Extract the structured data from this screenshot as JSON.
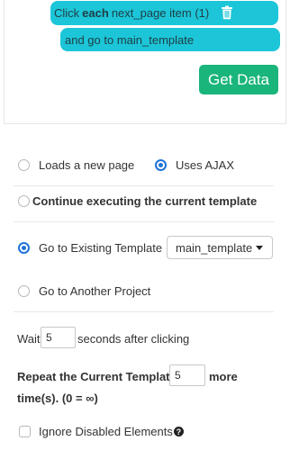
{
  "steps": {
    "click_prefix": "Click",
    "click_keyword": "each",
    "click_target": "next_page item (1)",
    "second_line": "and go to main_template"
  },
  "actions": {
    "get_data_label": "Get Data"
  },
  "load_type": {
    "new_page_label": "Loads a new page",
    "ajax_label": "Uses AJAX",
    "selected": "ajax"
  },
  "continue_label": "Continue executing the current template",
  "goto": {
    "existing_label": "Go to Existing Template",
    "selected_template": "main_template",
    "another_project_label": "Go to Another Project",
    "selected": "existing"
  },
  "wait": {
    "prefix": "Wait",
    "value": "5",
    "suffix": "seconds after clicking"
  },
  "repeat": {
    "prefix": "Repeat the Current Template",
    "value": "5",
    "suffix": "more",
    "line2": "time(s). (0 = ∞)"
  },
  "ignore_disabled_label": "Ignore Disabled Elements",
  "colors": {
    "pill": "#1cc6d8",
    "button": "#19b57a",
    "radio_accent": "#1e74d6"
  },
  "icons": {
    "trash": "trash-icon",
    "help": "question-circle-icon",
    "caret": "caret-down-icon"
  }
}
